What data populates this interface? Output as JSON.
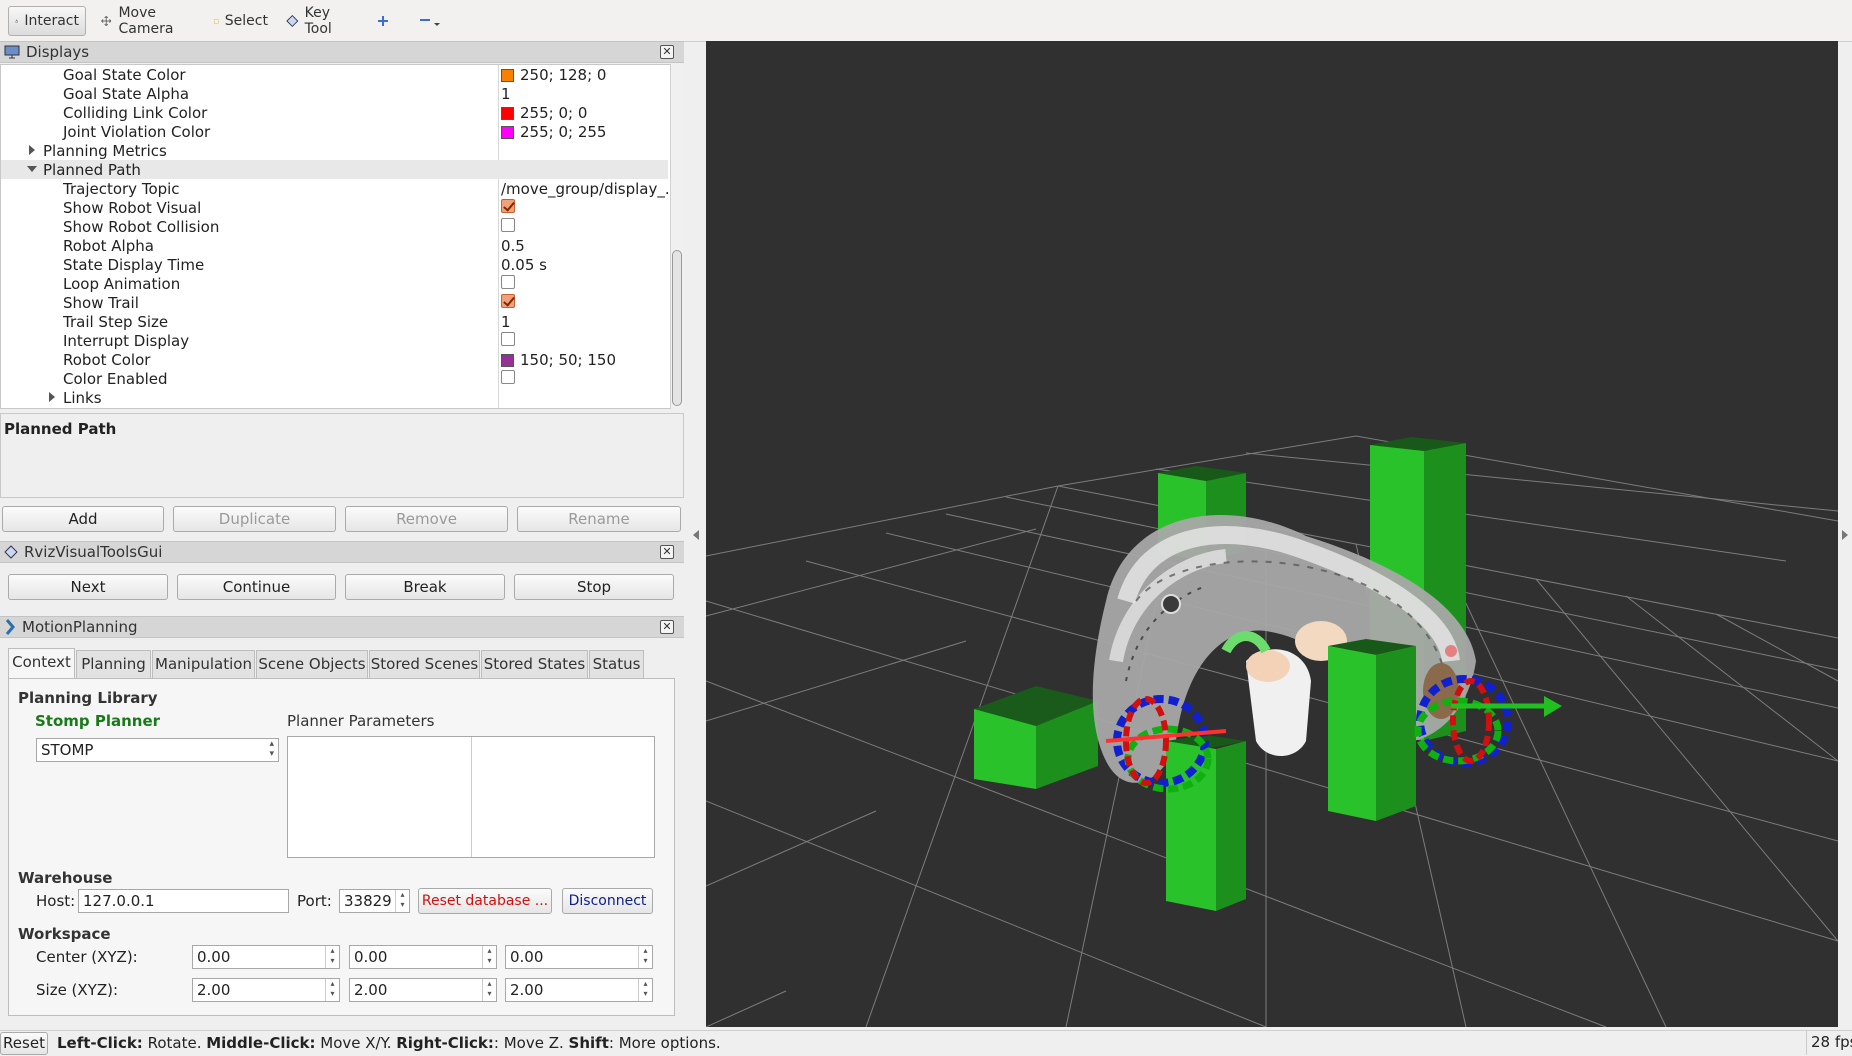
{
  "toolbar": {
    "interact": "Interact",
    "move_camera": "Move Camera",
    "select": "Select",
    "key_tool": "Key Tool"
  },
  "displays": {
    "title": "Displays",
    "rows": [
      {
        "label": "Goal State Color",
        "value": "250; 128; 0",
        "swatch": "#fa8000"
      },
      {
        "label": "Goal State Alpha",
        "value": "1"
      },
      {
        "label": "Colliding Link Color",
        "value": "255; 0; 0",
        "swatch": "#ff0000"
      },
      {
        "label": "Joint Violation Color",
        "value": "255; 0; 255",
        "swatch": "#ff00ff"
      },
      {
        "label": "Planning Metrics",
        "value": ""
      },
      {
        "label": "Planned Path",
        "value": ""
      },
      {
        "label": "Trajectory Topic",
        "value": "/move_group/display_..."
      },
      {
        "label": "Show Robot Visual",
        "checked": true
      },
      {
        "label": "Show Robot Collision",
        "checked": false
      },
      {
        "label": "Robot Alpha",
        "value": "0.5"
      },
      {
        "label": "State Display Time",
        "value": "0.05 s"
      },
      {
        "label": "Loop Animation",
        "checked": false
      },
      {
        "label": "Show Trail",
        "checked": true
      },
      {
        "label": "Trail Step Size",
        "value": "1"
      },
      {
        "label": "Interrupt Display",
        "checked": false
      },
      {
        "label": "Robot Color",
        "value": "150; 50; 150",
        "swatch": "#963296"
      },
      {
        "label": "Color Enabled",
        "checked": false
      },
      {
        "label": "Links",
        "value": ""
      }
    ],
    "description_title": "Planned Path",
    "buttons": {
      "add": "Add",
      "duplicate": "Duplicate",
      "remove": "Remove",
      "rename": "Rename"
    }
  },
  "rviz_visual_tools": {
    "title": "RvizVisualToolsGui",
    "buttons": {
      "next": "Next",
      "continue": "Continue",
      "break": "Break",
      "stop": "Stop"
    }
  },
  "motion_planning": {
    "title": "MotionPlanning",
    "tabs": [
      "Context",
      "Planning",
      "Manipulation",
      "Scene Objects",
      "Stored Scenes",
      "Stored States",
      "Status"
    ],
    "planning_library": "Planning Library",
    "planner_name": "Stomp Planner",
    "planner_select": "STOMP",
    "planner_parameters": "Planner Parameters",
    "warehouse": "Warehouse",
    "host_label": "Host:",
    "host_value": "127.0.0.1",
    "port_label": "Port:",
    "port_value": "33829",
    "reset_db": "Reset database ...",
    "disconnect": "Disconnect",
    "workspace": "Workspace",
    "center_label": "Center (XYZ):",
    "center": [
      "0.00",
      "0.00",
      "0.00"
    ],
    "size_label": "Size (XYZ):",
    "size": [
      "2.00",
      "2.00",
      "2.00"
    ]
  },
  "statusbar": {
    "reset": "Reset",
    "left_click": "Left-Click:",
    "left_click_desc": " Rotate. ",
    "middle_click": "Middle-Click:",
    "middle_click_desc": " Move X/Y. ",
    "right_click": "Right-Click:",
    "right_click_desc": ": Move Z. ",
    "shift": "Shift",
    "shift_desc": ": More options.",
    "fps": "28 fps"
  },
  "colors": {
    "viewport_bg": "#303030",
    "obstacle": "#22c022",
    "planner_name": "#1a7a1a",
    "reset_db": "#d01010",
    "disconnect": "#10208a"
  }
}
